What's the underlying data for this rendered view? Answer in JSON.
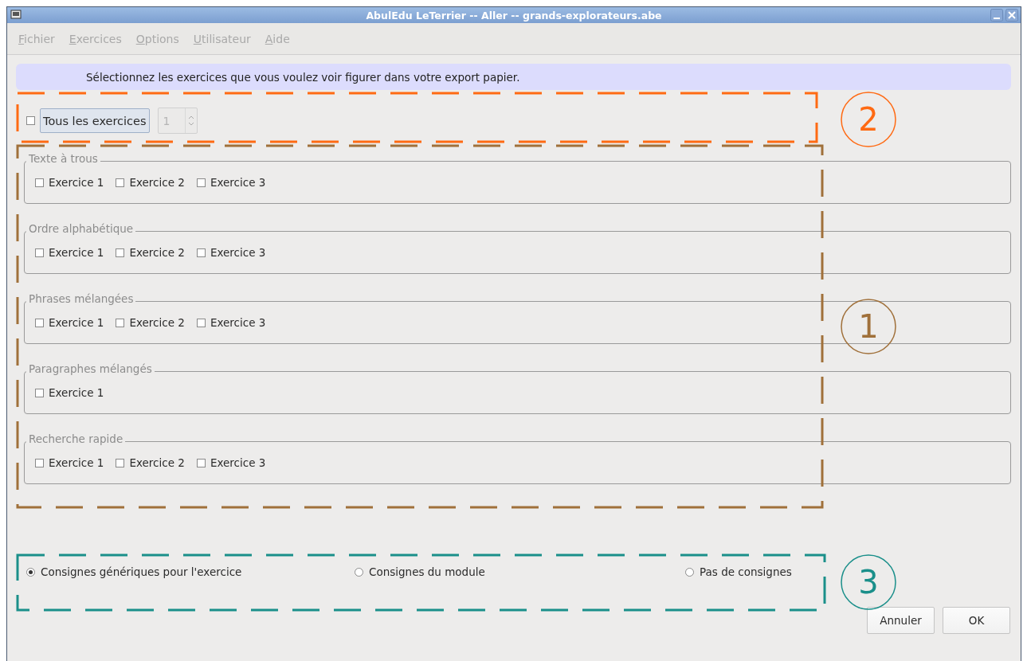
{
  "window": {
    "title": "AbulEdu LeTerrier -- Aller -- grands-explorateurs.abe"
  },
  "menu": [
    {
      "label": "Fichier",
      "disabled": true
    },
    {
      "label": "Exercices",
      "disabled": true
    },
    {
      "label": "Options",
      "disabled": true
    },
    {
      "label": "Utilisateur",
      "disabled": true
    },
    {
      "label": "Aide",
      "disabled": true
    }
  ],
  "banner": "Sélectionnez les exercices que vous voulez voir figurer dans votre export papier.",
  "all_exercises": {
    "label": "Tous les exercices",
    "checked": false,
    "spin_value": "1",
    "spin_disabled": true
  },
  "groups": [
    {
      "title": "Texte à trous",
      "items": [
        {
          "label": "Exercice 1",
          "checked": false
        },
        {
          "label": "Exercice 2",
          "checked": false
        },
        {
          "label": "Exercice 3",
          "checked": false
        }
      ]
    },
    {
      "title": "Ordre alphabétique",
      "items": [
        {
          "label": "Exercice 1",
          "checked": false
        },
        {
          "label": "Exercice 2",
          "checked": false
        },
        {
          "label": "Exercice 3",
          "checked": false
        }
      ]
    },
    {
      "title": "Phrases mélangées",
      "items": [
        {
          "label": "Exercice 1",
          "checked": false
        },
        {
          "label": "Exercice 2",
          "checked": false
        },
        {
          "label": "Exercice 3",
          "checked": false
        }
      ]
    },
    {
      "title": "Paragraphes mélangés",
      "items": [
        {
          "label": "Exercice 1",
          "checked": false
        }
      ]
    },
    {
      "title": "Recherche rapide",
      "items": [
        {
          "label": "Exercice 1",
          "checked": false
        },
        {
          "label": "Exercice 2",
          "checked": false
        },
        {
          "label": "Exercice 3",
          "checked": false
        }
      ]
    }
  ],
  "instructions": [
    {
      "label": "Consignes génériques pour l'exercice",
      "selected": true
    },
    {
      "label": "Consignes du module",
      "selected": false
    },
    {
      "label": "Pas de consignes",
      "selected": false
    }
  ],
  "buttons": [
    "Annuler",
    "OK"
  ],
  "annotations": [
    {
      "label": "2",
      "color": "#ff6a13"
    },
    {
      "label": "1",
      "color": "#a0703a"
    },
    {
      "label": "3",
      "color": "#1a8f8a"
    }
  ]
}
